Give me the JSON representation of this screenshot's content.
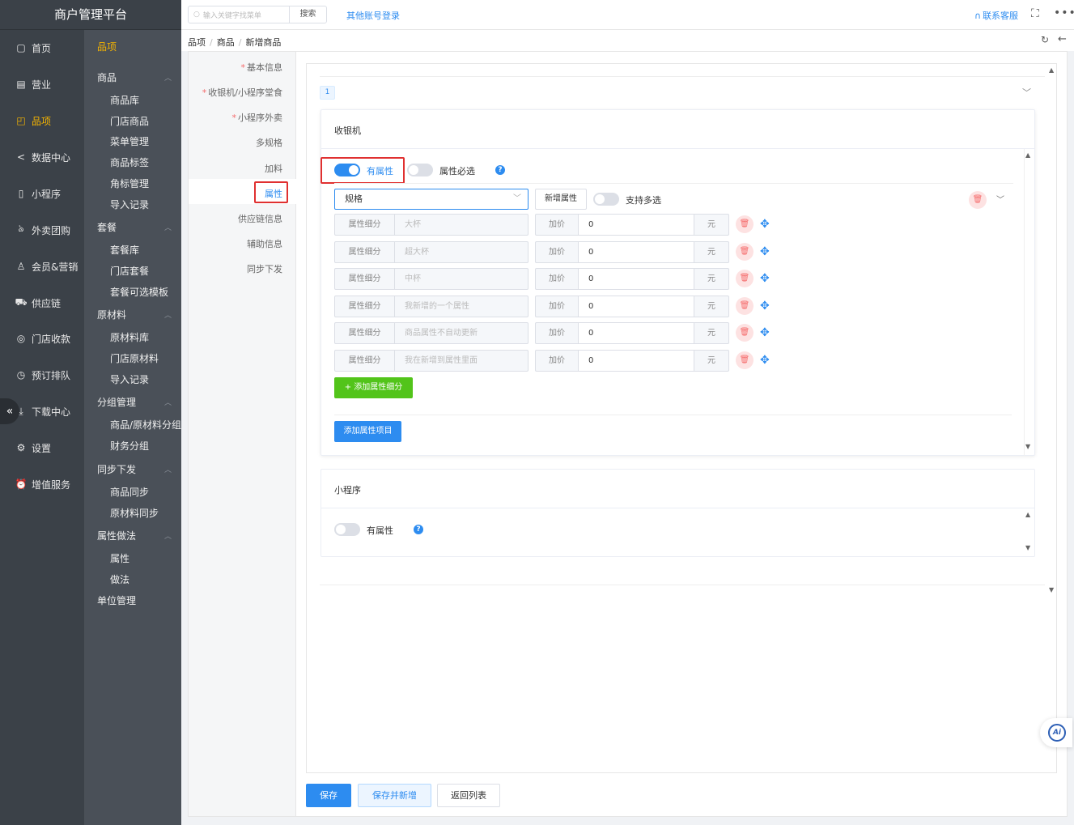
{
  "app": {
    "title": "商户管理平台"
  },
  "nav": {
    "items": [
      {
        "label": "首页",
        "icon": "home-icon"
      },
      {
        "label": "营业",
        "icon": "calendar-icon"
      },
      {
        "label": "品项",
        "icon": "bag-icon",
        "active": true
      },
      {
        "label": "数据中心",
        "icon": "share-icon"
      },
      {
        "label": "小程序",
        "icon": "phone-icon"
      },
      {
        "label": "外卖团购",
        "icon": "bike-icon"
      },
      {
        "label": "会员&营销",
        "icon": "user-icon"
      },
      {
        "label": "供应链",
        "icon": "truck-icon"
      },
      {
        "label": "门店收款",
        "icon": "coins-icon"
      },
      {
        "label": "预订排队",
        "icon": "clock-icon"
      },
      {
        "label": "下载中心",
        "icon": "download-icon"
      },
      {
        "label": "设置",
        "icon": "gear-icon"
      },
      {
        "label": "增值服务",
        "icon": "alarm-icon"
      }
    ]
  },
  "subnav": {
    "title": "品项",
    "groups": [
      {
        "label": "商品",
        "items": [
          "商品库",
          "门店商品",
          "菜单管理",
          "商品标签",
          "角标管理",
          "导入记录"
        ]
      },
      {
        "label": "套餐",
        "items": [
          "套餐库",
          "门店套餐",
          "套餐可选模板"
        ]
      },
      {
        "label": "原材料",
        "items": [
          "原材料库",
          "门店原材料",
          "导入记录"
        ]
      },
      {
        "label": "分组管理",
        "items": [
          "商品/原材料分组",
          "财务分组"
        ]
      },
      {
        "label": "同步下发",
        "items": [
          "商品同步",
          "原材料同步"
        ]
      },
      {
        "label": "属性做法",
        "items": [
          "属性",
          "做法"
        ]
      }
    ],
    "extra": "单位管理"
  },
  "topbar": {
    "search_placeholder": "输入关键字找菜单",
    "search_button": "搜索",
    "other_login": "其他账号登录",
    "contact": "联系客服"
  },
  "breadcrumb": [
    "品项",
    "商品",
    "新增商品"
  ],
  "tabs": [
    {
      "label": "基本信息",
      "required": true
    },
    {
      "label": "收银机/小程序堂食",
      "required": true
    },
    {
      "label": "小程序外卖",
      "required": true
    },
    {
      "label": "多规格",
      "required": false
    },
    {
      "label": "加料",
      "required": false
    },
    {
      "label": "属性",
      "required": false,
      "active": true
    },
    {
      "label": "供应链信息",
      "required": false
    },
    {
      "label": "辅助信息",
      "required": false
    },
    {
      "label": "同步下发",
      "required": false
    }
  ],
  "group_number": "1",
  "cashier": {
    "title": "收银机",
    "has_attr_label": "有属性",
    "has_attr_on": true,
    "attr_required_label": "属性必选",
    "attr_required_on": false,
    "spec_select": "规格",
    "new_attr_button": "新增属性",
    "multi_label": "支持多选",
    "multi_on": false,
    "rows": [
      {
        "label": "属性细分",
        "value": "大杯",
        "price_label": "加价",
        "price": "0",
        "unit": "元"
      },
      {
        "label": "属性细分",
        "value": "超大杯",
        "price_label": "加价",
        "price": "0",
        "unit": "元"
      },
      {
        "label": "属性细分",
        "value": "中杯",
        "price_label": "加价",
        "price": "0",
        "unit": "元"
      },
      {
        "label": "属性细分",
        "value": "我新增的一个属性",
        "price_label": "加价",
        "price": "0",
        "unit": "元"
      },
      {
        "label": "属性细分",
        "value": "商品属性不自动更新",
        "price_label": "加价",
        "price": "0",
        "unit": "元"
      },
      {
        "label": "属性细分",
        "value": "我在新增到属性里面",
        "price_label": "加价",
        "price": "0",
        "unit": "元"
      }
    ],
    "add_sub_button": "+ 添加属性细分",
    "add_project_button": "添加属性项目"
  },
  "miniprogram": {
    "title": "小程序",
    "has_attr_label": "有属性",
    "has_attr_on": false
  },
  "footer": {
    "save": "保存",
    "save_new": "保存并新增",
    "back_list": "返回列表"
  },
  "colors": {
    "accent": "#2d8cf0",
    "nav_active": "#f5b400",
    "highlight_box": "#e03030",
    "add_green": "#52c41a"
  }
}
